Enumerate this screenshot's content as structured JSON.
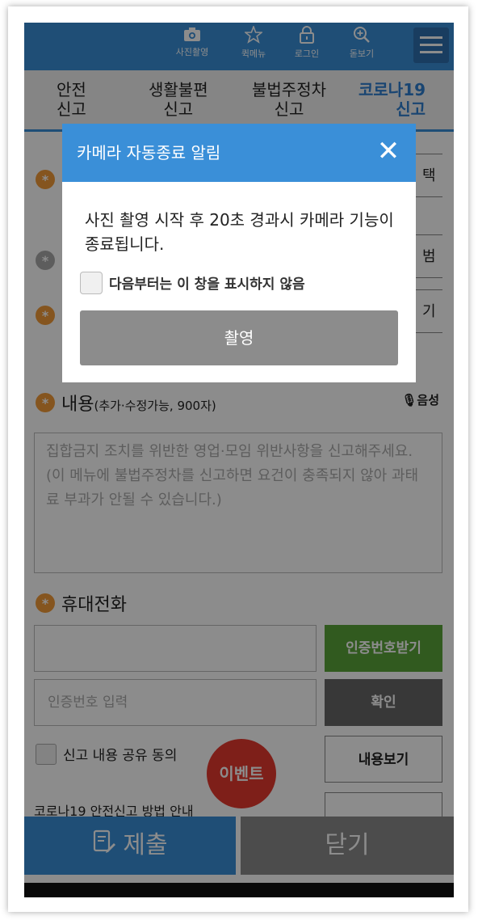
{
  "topbar": {
    "items": [
      {
        "icon": "camera-icon",
        "label": "사진촬영"
      },
      {
        "icon": "star-icon",
        "label": "퀵메뉴"
      },
      {
        "icon": "lock-icon",
        "label": "로그인"
      },
      {
        "icon": "zoom-icon",
        "label": "돋보기"
      }
    ]
  },
  "tabs": [
    {
      "line1": "안전",
      "line2": "신고"
    },
    {
      "line1": "생활불편",
      "line2": "신고"
    },
    {
      "line1": "불법주정차",
      "line2": "신고"
    },
    {
      "line1": "코로나19",
      "line2": "신고"
    }
  ],
  "form": {
    "side_buttons": [
      "택",
      "범",
      "기"
    ],
    "content_label": "내용",
    "content_note": "(추가·수정가능, 900자)",
    "voice_label": "음성",
    "content_placeholder": "집합금지 조치를 위반한 영업·모임 위반사항을 신고해주세요. (이 메뉴에 불법주정차를 신고하면 요건이 충족되지 않아 과태료 부과가 안될 수 있습니다.)",
    "phone_label": "휴대전화",
    "request_code_button": "인증번호받기",
    "code_placeholder": "인증번호 입력",
    "confirm_button": "확인",
    "share_consent_label": "신고 내용 공유 동의",
    "view_content_button": "내용보기",
    "guide_text_cut": "코로나19 안전신고 방법 안내"
  },
  "event_badge": "이벤트",
  "bottom": {
    "submit": "제출",
    "close": "닫기"
  },
  "modal": {
    "title": "카메라 자동종료 알림",
    "message": "사진 촬영 시작 후 20초 경과시 카메라 기능이 종료됩니다.",
    "checkbox_label": "다음부터는 이 창을 표시하지 않음",
    "action_button": "촬영"
  },
  "colors": {
    "primary": "#3a8fd8",
    "accent_orange": "#f39c3a",
    "green": "#5aa43a",
    "event_red": "#e53a2f"
  }
}
